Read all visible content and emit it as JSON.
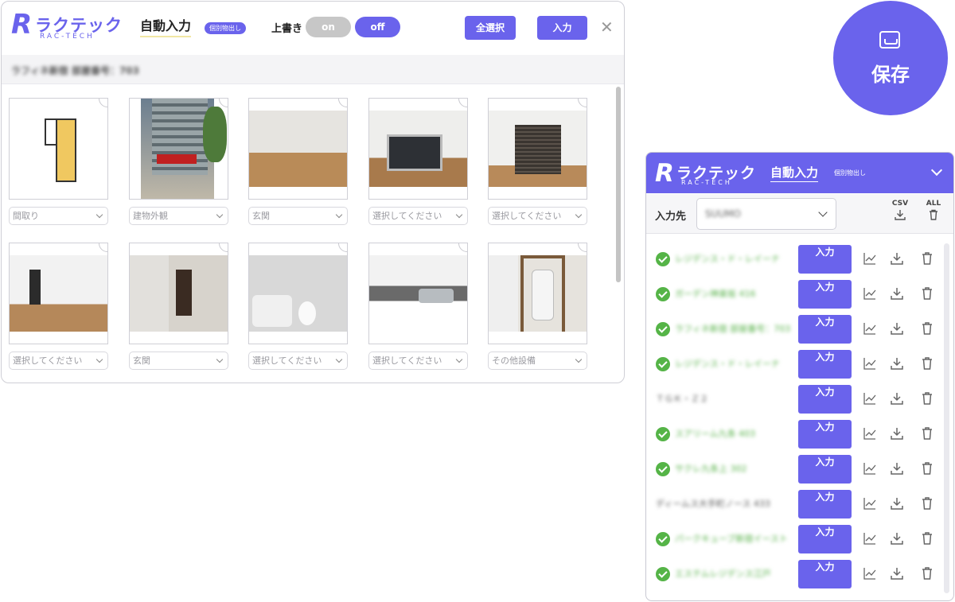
{
  "main": {
    "logo": {
      "mark": "R",
      "kana": "ラクテック",
      "en": "RAC-TECH"
    },
    "mode_title": "自動入力",
    "mode_badge": "個別物出し",
    "overwrite_label": "上書き",
    "toggle_on": "on",
    "toggle_off": "off",
    "select_all_label": "全選択",
    "input_label": "入力",
    "close_label": "✕",
    "property_title": "ラフィネ新宿 部屋番号：703",
    "photos": [
      {
        "category": "間取り"
      },
      {
        "category": "建物外観"
      },
      {
        "category": "玄関"
      },
      {
        "category": "選択してください"
      },
      {
        "category": "選択してください"
      },
      {
        "category": "選択してください"
      },
      {
        "category": "玄関"
      },
      {
        "category": "選択してください"
      },
      {
        "category": "選択してください"
      },
      {
        "category": "その他設備"
      }
    ]
  },
  "save": {
    "label": "保存",
    "icon": "inbox-tray-icon"
  },
  "side": {
    "logo": {
      "mark": "R",
      "kana": "ラクテック",
      "en": "RAC-TECH"
    },
    "mode_title": "自動入力",
    "mode_badge": "個別物出し",
    "dest_label": "入力先",
    "dest_value": "SUUMO",
    "csv_label": "CSV",
    "all_label": "ALL",
    "rows": [
      {
        "name": "レジデンス・ド・レイーナ",
        "status": "done",
        "button": "入力"
      },
      {
        "name": "ガーデン神楽坂 416",
        "status": "done",
        "button": "入力"
      },
      {
        "name": "ラフィネ新宿 部屋番号：703",
        "status": "done",
        "button": "入力"
      },
      {
        "name": "レジデンス・ド・レイーナ",
        "status": "done",
        "button": "入力"
      },
      {
        "name": "ＴＧＫ・Ｚ２",
        "status": "none",
        "button": "入力"
      },
      {
        "name": "スアリーム九条 403",
        "status": "done",
        "button": "入力"
      },
      {
        "name": "サクレ九条上 302",
        "status": "done",
        "button": "入力"
      },
      {
        "name": "ディームス大手町ノース 433",
        "status": "none",
        "button": "入力"
      },
      {
        "name": "パークキューブ新宿イースト",
        "status": "done",
        "button": "入力"
      },
      {
        "name": "エステムレジデンス江戸",
        "status": "done",
        "button": "入力"
      }
    ]
  }
}
